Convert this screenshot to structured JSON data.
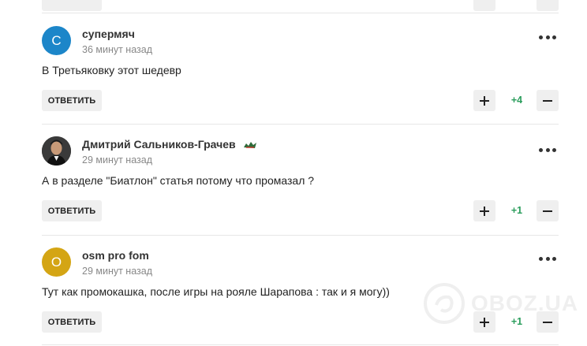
{
  "comments": [
    {
      "avatar_letter": "C",
      "avatar_color": "#1c86c9",
      "author": "супермяч",
      "time": "36 минут назад",
      "text": "В Третьяковку этот шедевр",
      "reply_label": "Ответить",
      "score": "+4",
      "score_color": "#2a9d5c"
    },
    {
      "avatar_letter": "",
      "avatar_color": "#2b2b2b",
      "author": "Дмитрий Сальников-Грачев",
      "author_badge": "club-badge-icon",
      "time": "29 минут назад",
      "text": "А в разделе \"Биатлон\" статья потому что промазал ?",
      "reply_label": "Ответить",
      "score": "+1",
      "score_color": "#2a9d5c"
    },
    {
      "avatar_letter": "O",
      "avatar_color": "#d4a514",
      "author": "osm pro fom",
      "time": "29 минут назад",
      "text": "Тут как промокашка, после игры на рояле Шарапова : так и я могу))",
      "reply_label": "Ответить",
      "score": "+1",
      "score_color": "#2a9d5c"
    }
  ],
  "watermark": {
    "text": "OBOZ.UA"
  },
  "icons": {
    "more": "more-dots-icon",
    "plus": "plus-icon",
    "minus": "minus-icon"
  }
}
